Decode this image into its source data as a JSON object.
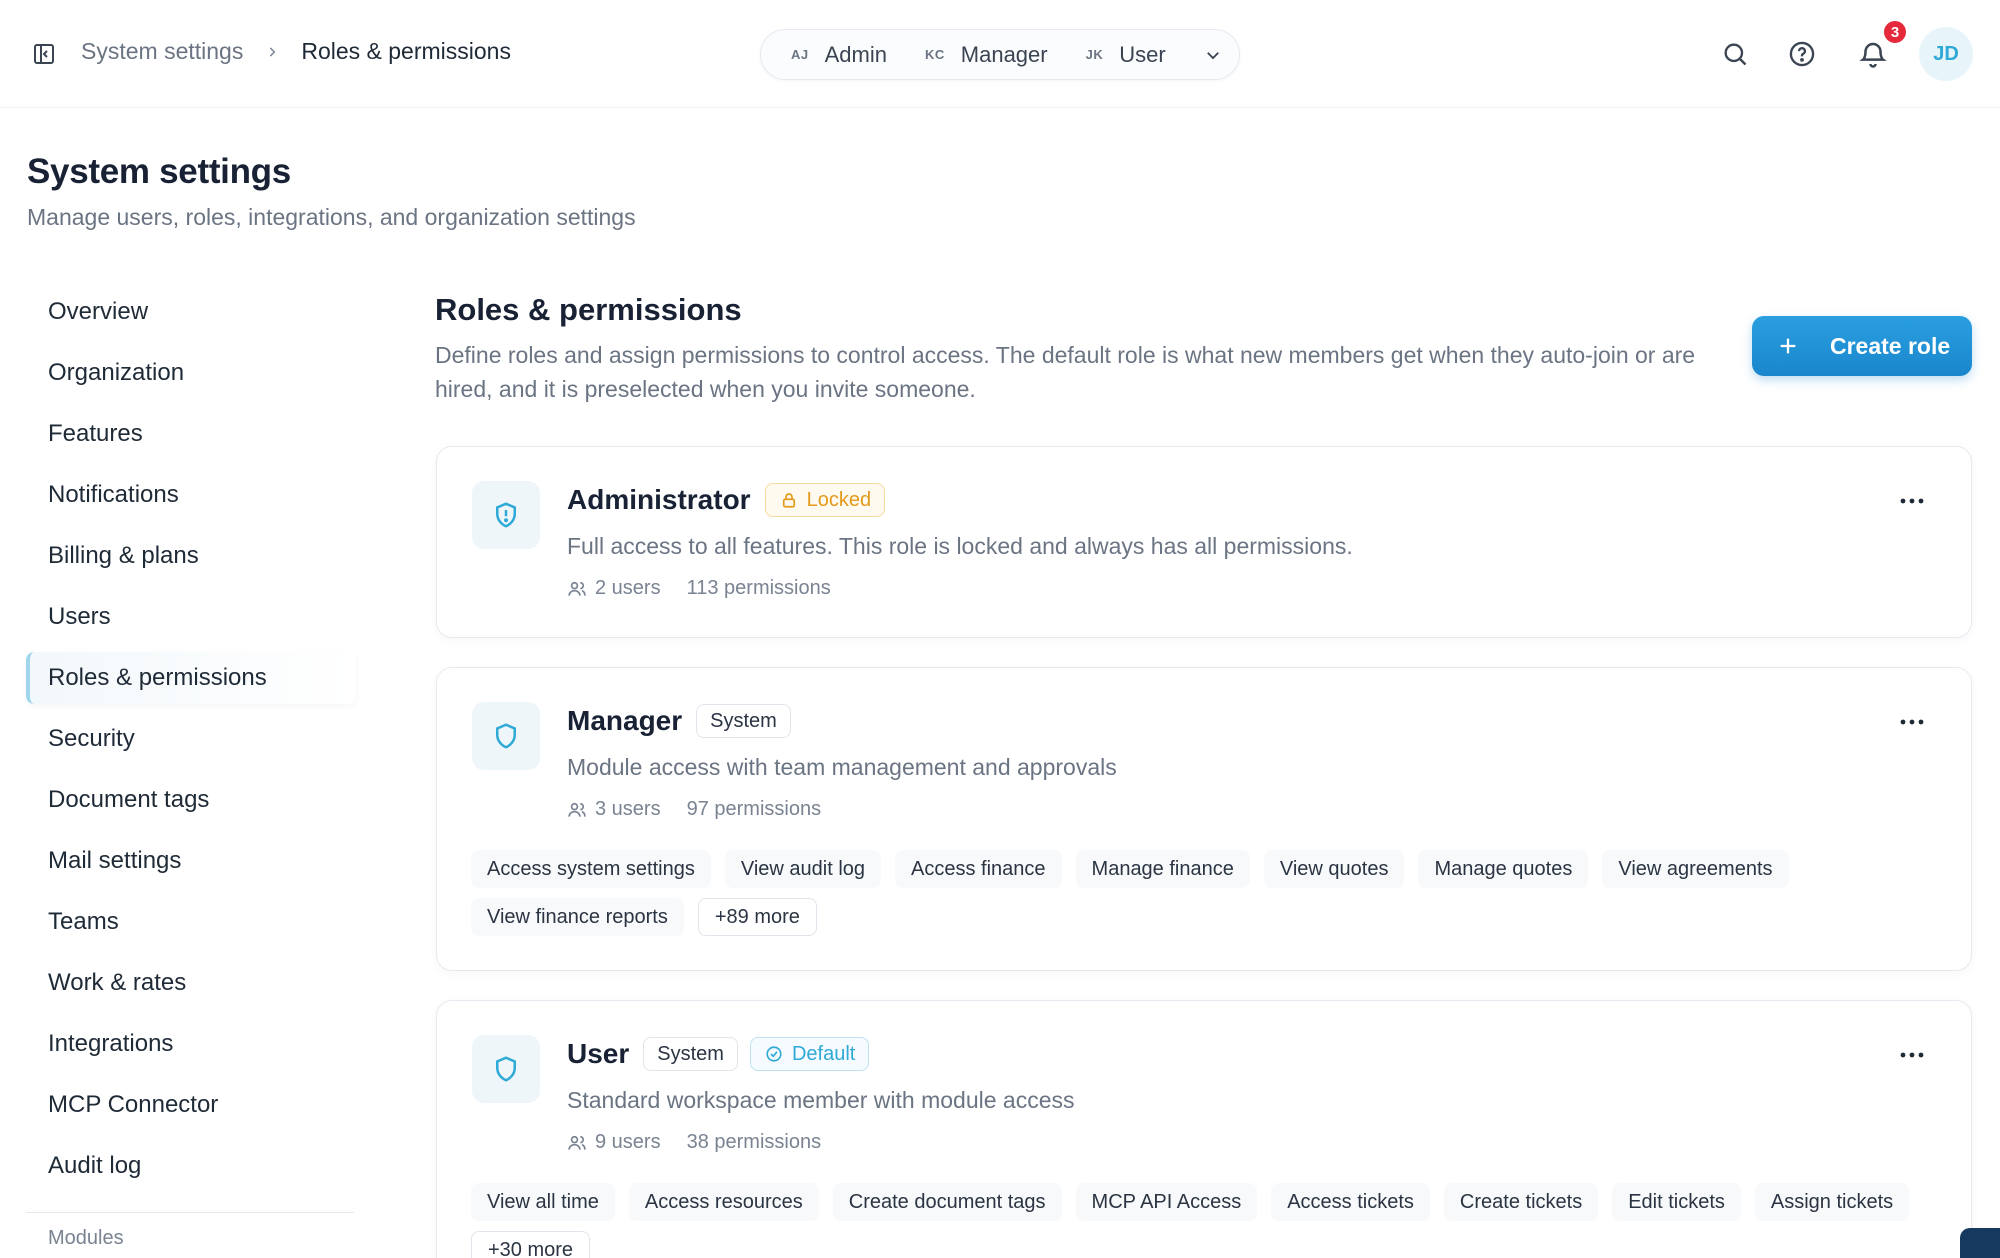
{
  "breadcrumb": {
    "root": "System settings",
    "current": "Roles & permissions"
  },
  "role_switcher": {
    "items": [
      {
        "initials": "AJ",
        "name": "Admin"
      },
      {
        "initials": "KC",
        "name": "Manager"
      },
      {
        "initials": "JK",
        "name": "User"
      }
    ]
  },
  "header": {
    "notification_count": "3",
    "avatar_initials": "JD"
  },
  "page": {
    "title": "System settings",
    "subtitle": "Manage users, roles, integrations, and organization settings"
  },
  "nav": {
    "items": [
      {
        "label": "Overview"
      },
      {
        "label": "Organization"
      },
      {
        "label": "Features"
      },
      {
        "label": "Notifications"
      },
      {
        "label": "Billing & plans"
      },
      {
        "label": "Users"
      },
      {
        "label": "Roles & permissions"
      },
      {
        "label": "Security"
      },
      {
        "label": "Document tags"
      },
      {
        "label": "Mail settings"
      },
      {
        "label": "Teams"
      },
      {
        "label": "Work & rates"
      },
      {
        "label": "Integrations"
      },
      {
        "label": "MCP Connector"
      },
      {
        "label": "Audit log"
      }
    ],
    "section_label": "Modules"
  },
  "main": {
    "title": "Roles & permissions",
    "description": "Define roles and assign permissions to control access. The default role is what new members get when they auto-join or are hired, and it is preselected when you invite someone.",
    "create_button": "Create role"
  },
  "roles": [
    {
      "name": "Administrator",
      "badge_locked": "Locked",
      "description": "Full access to all features. This role is locked and always has all permissions.",
      "users": "2 users",
      "permissions": "113 permissions"
    },
    {
      "name": "Manager",
      "badge_system": "System",
      "description": "Module access with team management and approvals",
      "users": "3 users",
      "permissions": "97 permissions",
      "tags": [
        "Access system settings",
        "View audit log",
        "Access finance",
        "Manage finance",
        "View quotes",
        "Manage quotes",
        "View agreements",
        "View finance reports"
      ],
      "more": "+89 more"
    },
    {
      "name": "User",
      "badge_system": "System",
      "badge_default": "Default",
      "description": "Standard workspace member with module access",
      "users": "9 users",
      "permissions": "38 permissions",
      "tags": [
        "View all time",
        "Access resources",
        "Create document tags",
        "MCP API Access",
        "Access tickets",
        "Create tickets",
        "Edit tickets",
        "Assign tickets"
      ],
      "more": "+30 more"
    }
  ],
  "colors": {
    "accent": "#1a86cc",
    "badge_red": "#e5293b",
    "locked": "#e29a1b",
    "default": "#2fa9d6"
  }
}
